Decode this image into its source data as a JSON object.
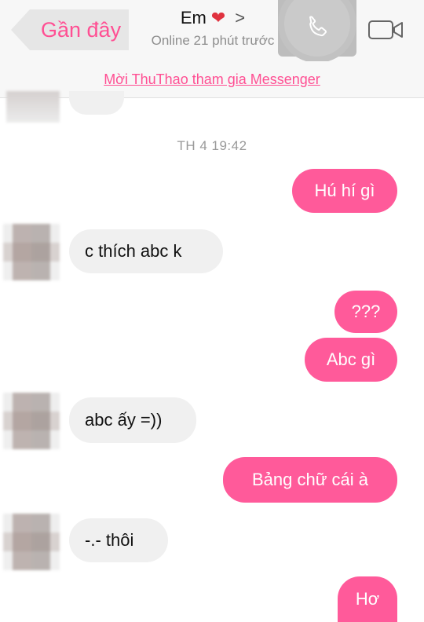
{
  "header": {
    "back_label": "Gần đây",
    "contact_name": "Em",
    "heart": "❤",
    "chevron": ">",
    "status": "Online 21 phút trước",
    "call_icon": "phone-icon",
    "video_icon": "video-camera-icon"
  },
  "invite_text": "Mời ThuThao tham gia Messenger",
  "timestamp": "TH 4 19:42",
  "messages": [
    {
      "from": "me",
      "text": "Hú hí gì"
    },
    {
      "from": "them",
      "text": "c thích abc k"
    },
    {
      "from": "me",
      "text": "???"
    },
    {
      "from": "me",
      "text": "Abc gì"
    },
    {
      "from": "them",
      "text": "abc ấy =))"
    },
    {
      "from": "me",
      "text": "Bảng chữ cái à"
    },
    {
      "from": "them",
      "text": "-.- thôi"
    },
    {
      "from": "me",
      "text": "Hơ"
    }
  ],
  "colors": {
    "accent": "#ff4f93",
    "outgoing_bubble": "#ff5a9a",
    "incoming_bubble": "#f0f0f0",
    "header_bg": "#f7f7f7"
  }
}
